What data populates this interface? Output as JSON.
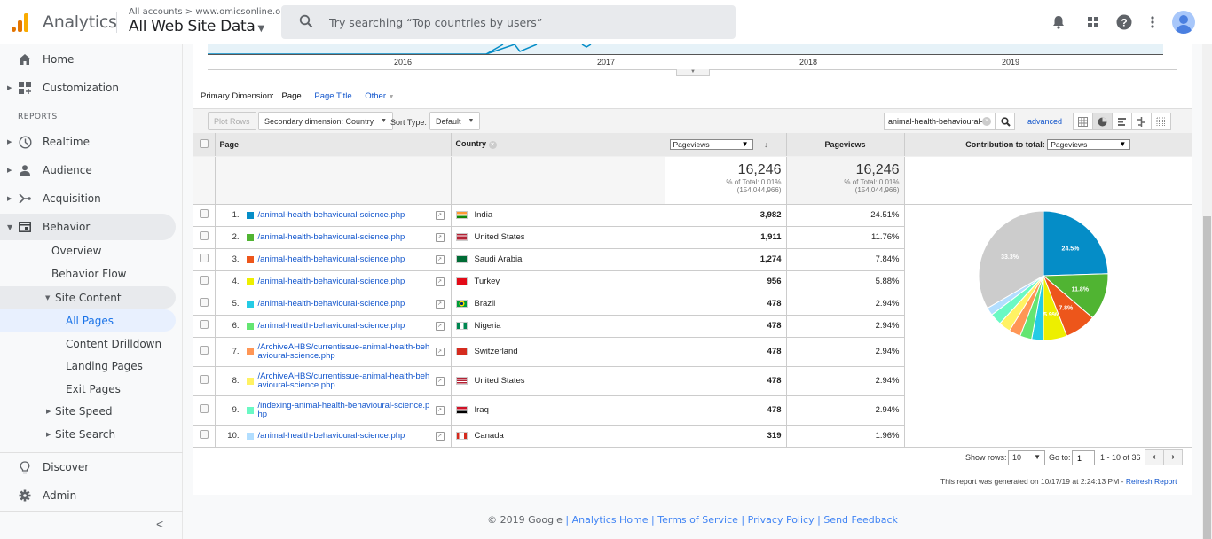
{
  "header": {
    "app_name": "Analytics",
    "breadcrumb": "All accounts > www.omicsonline.org",
    "property": "All Web Site Data",
    "search_placeholder": "Try searching “Top countries by users”",
    "icons": [
      "bell-icon",
      "apps-grid-icon",
      "help-icon",
      "more-vert-icon",
      "account-avatar"
    ]
  },
  "sidebar": {
    "home": "Home",
    "customization": "Customization",
    "reports_label": "REPORTS",
    "realtime": "Realtime",
    "audience": "Audience",
    "acquisition": "Acquisition",
    "behavior": "Behavior",
    "behavior_items": {
      "overview": "Overview",
      "flow": "Behavior Flow",
      "site_content": "Site Content",
      "all_pages": "All Pages",
      "content_drilldown": "Content Drilldown",
      "landing_pages": "Landing Pages",
      "exit_pages": "Exit Pages",
      "site_speed": "Site Speed",
      "site_search": "Site Search"
    },
    "discover": "Discover",
    "admin": "Admin",
    "collapse": "<"
  },
  "timeline": {
    "years": [
      "2016",
      "2017",
      "2018",
      "2019"
    ]
  },
  "primary_dimension": {
    "label": "Primary Dimension:",
    "current": "Page",
    "options": [
      "Page Title",
      "Other"
    ]
  },
  "toolbar": {
    "plot_rows": "Plot Rows",
    "secondary_dimension": "Secondary dimension: Country",
    "sort_type_label": "Sort Type:",
    "sort_type_value": "Default",
    "filter_value": "animal-health-behavioural-",
    "advanced": "advanced"
  },
  "table": {
    "headers": {
      "page": "Page",
      "country": "Country",
      "metric_select": "Pageviews",
      "metric2": "Pageviews",
      "contribution_label": "Contribution to total:",
      "contribution_select": "Pageviews"
    },
    "summary": {
      "value": "16,246",
      "pct_of_total": "% of Total: 0.01%",
      "total": "(154,044,966)"
    },
    "rows": [
      {
        "n": "1.",
        "color": "#058dc7",
        "page": "/animal-health-behavioural-science.php",
        "country": "India",
        "pageviews": "3,982",
        "pct": "24.51%"
      },
      {
        "n": "2.",
        "color": "#50b432",
        "page": "/animal-health-behavioural-science.php",
        "country": "United States",
        "pageviews": "1,911",
        "pct": "11.76%"
      },
      {
        "n": "3.",
        "color": "#ed561b",
        "page": "/animal-health-behavioural-science.php",
        "country": "Saudi Arabia",
        "pageviews": "1,274",
        "pct": "7.84%"
      },
      {
        "n": "4.",
        "color": "#edef00",
        "page": "/animal-health-behavioural-science.php",
        "country": "Turkey",
        "pageviews": "956",
        "pct": "5.88%"
      },
      {
        "n": "5.",
        "color": "#24cbe5",
        "page": "/animal-health-behavioural-science.php",
        "country": "Brazil",
        "pageviews": "478",
        "pct": "2.94%"
      },
      {
        "n": "6.",
        "color": "#64e572",
        "page": "/animal-health-behavioural-science.php",
        "country": "Nigeria",
        "pageviews": "478",
        "pct": "2.94%"
      },
      {
        "n": "7.",
        "color": "#ff9655",
        "page": "/ArchiveAHBS/currentissue-animal-health-behavioural-science.php",
        "country": "Switzerland",
        "pageviews": "478",
        "pct": "2.94%"
      },
      {
        "n": "8.",
        "color": "#fff263",
        "page": "/ArchiveAHBS/currentissue-animal-health-behavioural-science.php",
        "country": "United States",
        "pageviews": "478",
        "pct": "2.94%"
      },
      {
        "n": "9.",
        "color": "#6af9c4",
        "page": "/indexing-animal-health-behavioural-science.php",
        "country": "Iraq",
        "pageviews": "478",
        "pct": "2.94%"
      },
      {
        "n": "10.",
        "color": "#b2deff",
        "page": "/animal-health-behavioural-science.php",
        "country": "Canada",
        "pageviews": "319",
        "pct": "1.96%"
      }
    ]
  },
  "chart_data": {
    "type": "pie",
    "title": "Contribution to total: Pageviews",
    "categories": [
      "India",
      "United States",
      "Saudi Arabia",
      "Turkey",
      "Brazil",
      "Nigeria",
      "Switzerland",
      "United States (Archive)",
      "Iraq",
      "Canada",
      "Other"
    ],
    "values": [
      24.51,
      11.76,
      7.84,
      5.88,
      2.94,
      2.94,
      2.94,
      2.94,
      2.94,
      1.96,
      33.35
    ],
    "colors": [
      "#058dc7",
      "#50b432",
      "#ed561b",
      "#edef00",
      "#24cbe5",
      "#64e572",
      "#ff9655",
      "#fff263",
      "#6af9c4",
      "#b2deff",
      "#cccccc"
    ],
    "labels": [
      "24.5%",
      "11.8%",
      "7.8%",
      "5.9%",
      "",
      "",
      "",
      "",
      "",
      "",
      "33.3%"
    ]
  },
  "pagination": {
    "show_rows_label": "Show rows:",
    "show_rows_value": "10",
    "goto_label": "Go to:",
    "goto_value": "1",
    "range": "1 - 10 of 36"
  },
  "report_info": {
    "generated": "This report was generated on 10/17/19 at 2:24:13 PM - ",
    "refresh": "Refresh Report"
  },
  "footer": {
    "copyright": "© 2019 Google",
    "links": [
      "Analytics Home",
      "Terms of Service",
      "Privacy Policy",
      "Send Feedback"
    ]
  }
}
